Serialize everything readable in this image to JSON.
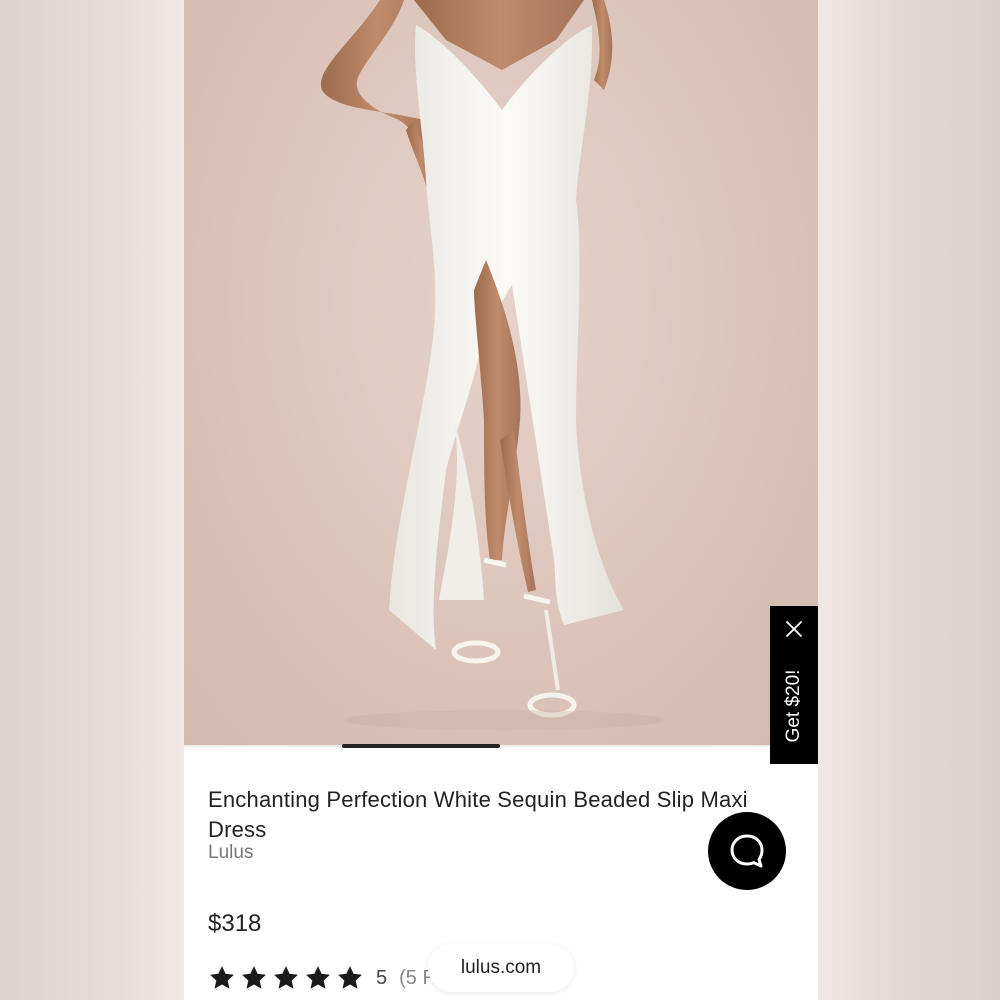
{
  "product": {
    "title": "Enchanting Perfection White Sequin Beaded Slip Maxi Dress",
    "brand": "Lulus",
    "price": "$318",
    "rating_value": "5",
    "rating_count": "(5 R",
    "stars": 5
  },
  "promo": {
    "label": "Get $20!",
    "close_icon": "close-icon"
  },
  "chat": {
    "icon": "chat-bubble-icon"
  },
  "browser": {
    "url": "lulus.com"
  },
  "colors": {
    "promo_bg": "#000000",
    "chat_bg": "#000000",
    "star": "#1a1a1a",
    "dress": "#f4f2ee",
    "backdrop": "#dcc4ba"
  }
}
